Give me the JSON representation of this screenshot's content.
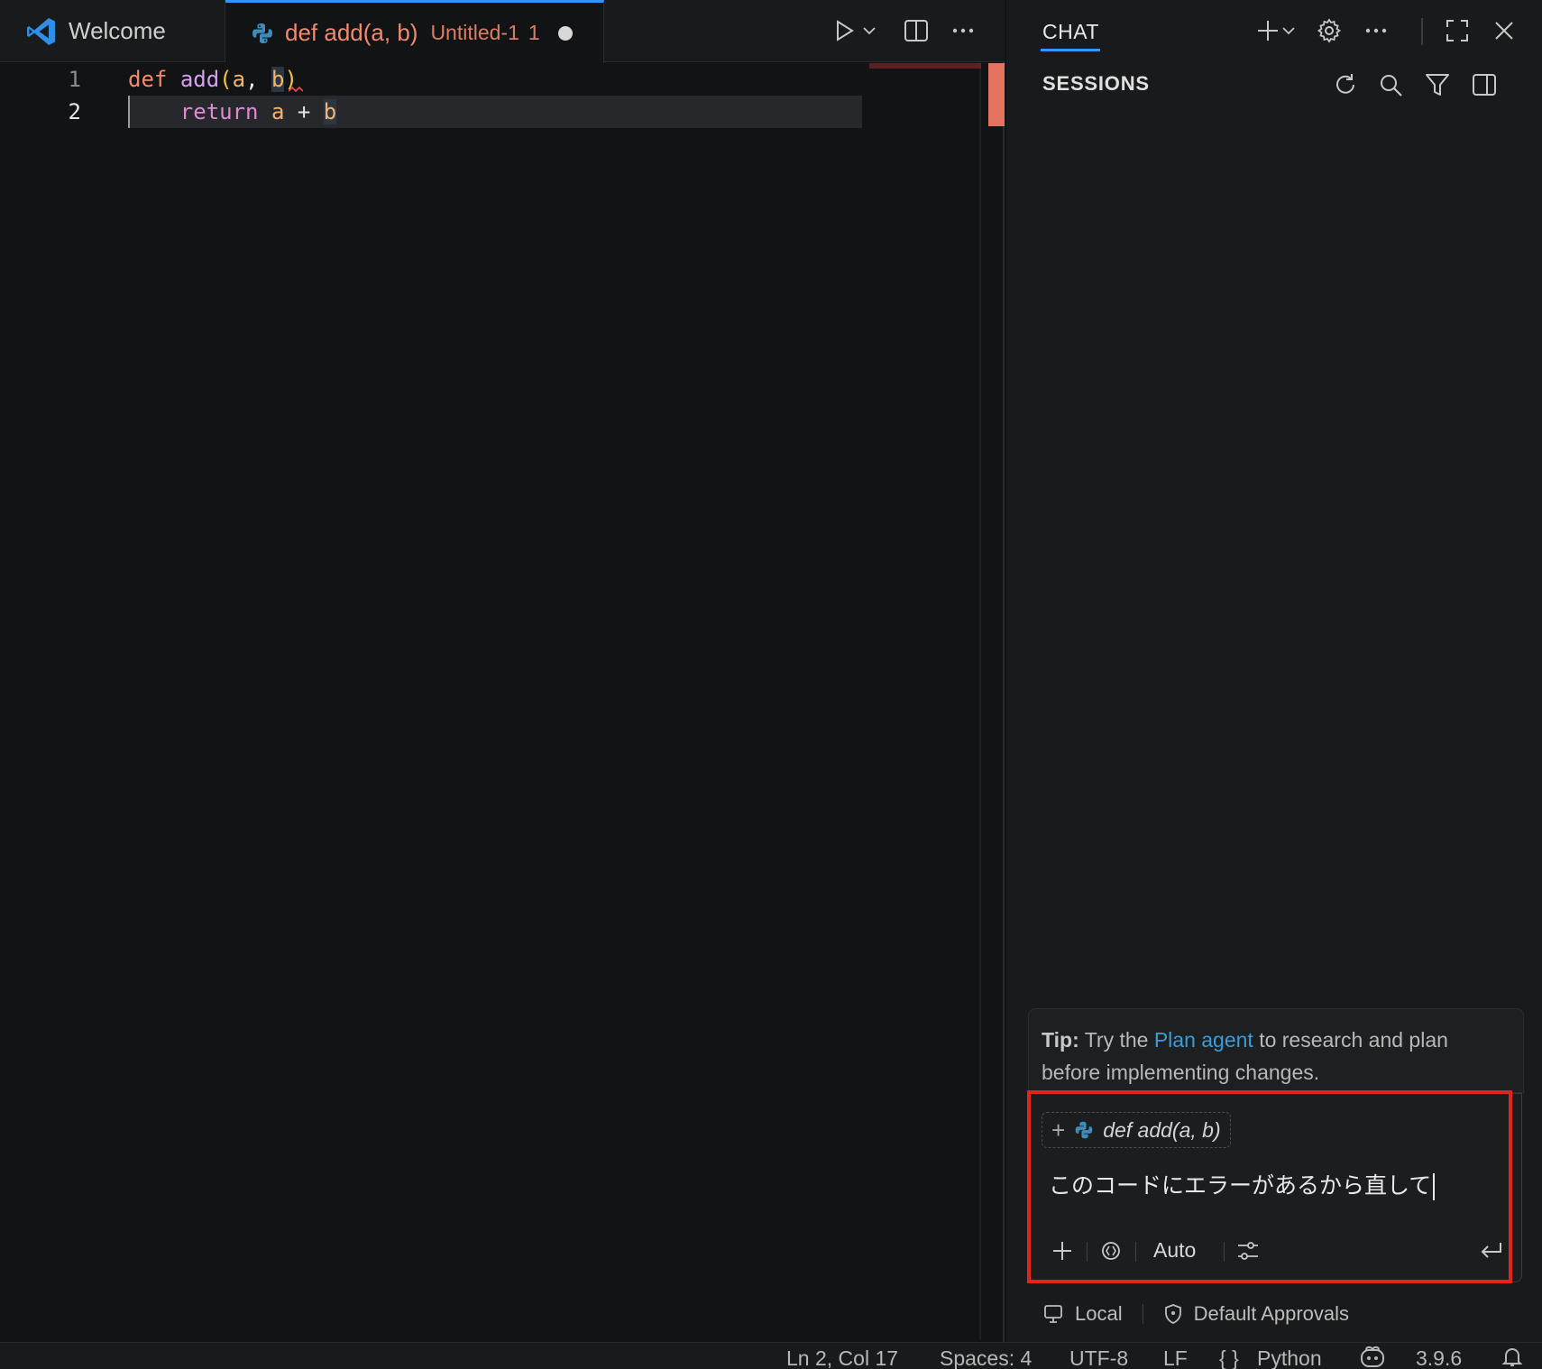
{
  "tabs": {
    "welcome": {
      "label": "Welcome"
    },
    "untitled": {
      "label": "def add(a, b)",
      "description": "Untitled-1",
      "problems": "1"
    }
  },
  "editor": {
    "lines": [
      {
        "number": "1"
      },
      {
        "number": "2"
      }
    ],
    "line1": {
      "kw": "def",
      "fn": "add",
      "open": "(",
      "a": "a",
      "comma": ", ",
      "b": "b",
      "close": ")"
    },
    "line2": {
      "indent": "    ",
      "kw": "return",
      "a": " a",
      "op": " + ",
      "b": "b"
    }
  },
  "chat": {
    "title": "CHAT",
    "sessions_label": "SESSIONS",
    "tip": {
      "prefix": "Tip:",
      "before_link": " Try the ",
      "link": "Plan agent",
      "after_link": " to research and plan before implementing changes."
    },
    "context_chip": "def add(a, b)",
    "input_value": "このコードにエラーがあるから直して",
    "mode": "Auto",
    "footer": {
      "location": "Local",
      "approvals": "Default Approvals"
    }
  },
  "status_bar": {
    "position": "Ln 2, Col 17",
    "spaces": "Spaces: 4",
    "encoding": "UTF-8",
    "eol": "LF",
    "language_braces": "{ }",
    "language": "Python",
    "python_version": "3.9.6"
  },
  "colors": {
    "accent": "#3794ff",
    "highlight_outline": "#e3241a",
    "tab_modified": "#f18a6e"
  }
}
